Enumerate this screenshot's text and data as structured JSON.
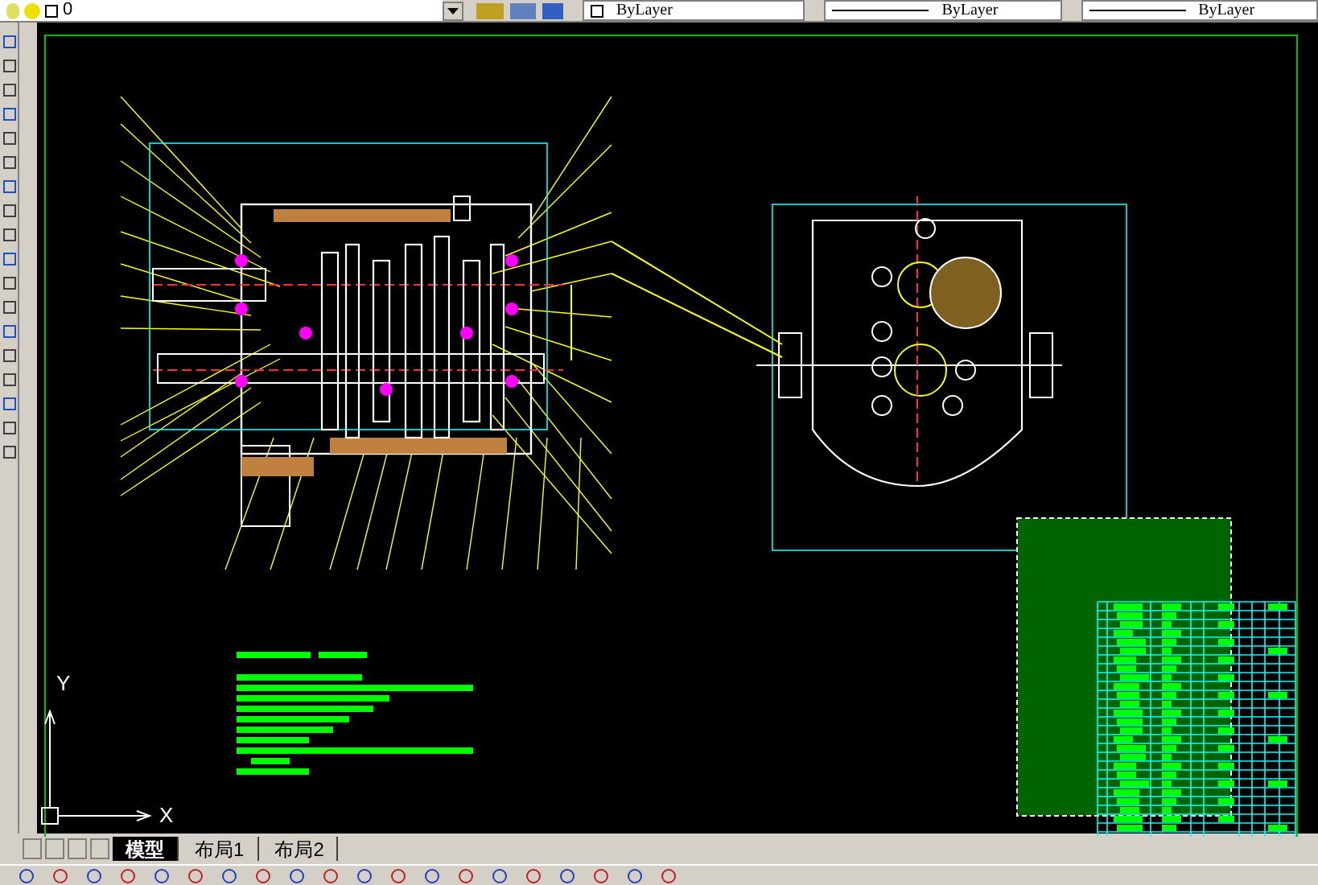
{
  "toolbar": {
    "layer": "0",
    "properties": [
      "ByLayer",
      "ByLayer",
      "ByLayer"
    ]
  },
  "ucs": {
    "x_label": "X",
    "y_label": "Y"
  },
  "tabs": [
    {
      "label": "模型",
      "selected": true
    },
    {
      "label": "布局1",
      "selected": false
    },
    {
      "label": "布局2",
      "selected": false
    }
  ]
}
